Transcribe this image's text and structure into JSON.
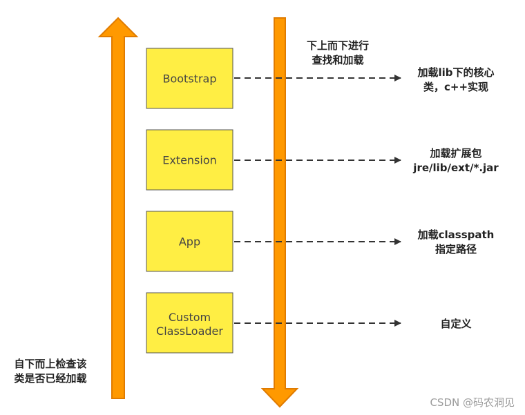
{
  "colors": {
    "arrow_fill": "#FF9900",
    "arrow_stroke": "#E07B00",
    "box_fill": "#FFEE44",
    "box_stroke": "#555555",
    "dash": "#333333"
  },
  "left_arrow": {
    "direction": "up",
    "label_lines": [
      "自下而上检查该",
      "类是否已经加载"
    ]
  },
  "right_arrow": {
    "direction": "down",
    "label_lines": [
      "下上而下进行",
      "查找和加载"
    ]
  },
  "loaders": [
    {
      "name_lines": [
        "Bootstrap"
      ],
      "note_lines": [
        "加载lib下的核心",
        "类，c++实现"
      ]
    },
    {
      "name_lines": [
        "Extension"
      ],
      "note_lines": [
        "加载扩展包",
        "jre/lib/ext/*.jar"
      ]
    },
    {
      "name_lines": [
        "App"
      ],
      "note_lines": [
        "加载classpath",
        "指定路径"
      ]
    },
    {
      "name_lines": [
        "Custom",
        "ClassLoader"
      ],
      "note_lines": [
        "自定义"
      ]
    }
  ],
  "watermark": "CSDN @码农洞见"
}
